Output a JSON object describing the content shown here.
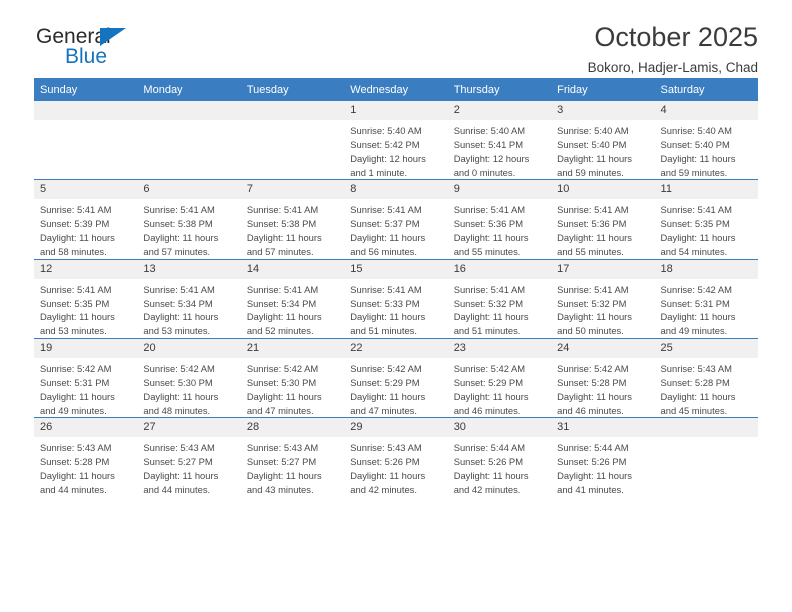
{
  "brand": {
    "word_one": "General",
    "word_two": "Blue"
  },
  "header": {
    "title": "October 2025",
    "subtitle": "Bokoro, Hadjer-Lamis, Chad"
  },
  "weekdays": [
    "Sunday",
    "Monday",
    "Tuesday",
    "Wednesday",
    "Thursday",
    "Friday",
    "Saturday"
  ],
  "colors": {
    "header_blue": "#3a7dc0",
    "brand_blue": "#1574bf",
    "daynum_band": "#f0f0f0",
    "text": "#3b3b3b"
  },
  "weeks": [
    [
      {
        "day": "",
        "empty": true,
        "sunrise": "",
        "sunset": "",
        "daylight_line1": "",
        "daylight_line2": ""
      },
      {
        "day": "",
        "empty": true,
        "sunrise": "",
        "sunset": "",
        "daylight_line1": "",
        "daylight_line2": ""
      },
      {
        "day": "",
        "empty": true,
        "sunrise": "",
        "sunset": "",
        "daylight_line1": "",
        "daylight_line2": ""
      },
      {
        "day": "1",
        "empty": false,
        "sunrise": "Sunrise: 5:40 AM",
        "sunset": "Sunset: 5:42 PM",
        "daylight_line1": "Daylight: 12 hours",
        "daylight_line2": "and 1 minute."
      },
      {
        "day": "2",
        "empty": false,
        "sunrise": "Sunrise: 5:40 AM",
        "sunset": "Sunset: 5:41 PM",
        "daylight_line1": "Daylight: 12 hours",
        "daylight_line2": "and 0 minutes."
      },
      {
        "day": "3",
        "empty": false,
        "sunrise": "Sunrise: 5:40 AM",
        "sunset": "Sunset: 5:40 PM",
        "daylight_line1": "Daylight: 11 hours",
        "daylight_line2": "and 59 minutes."
      },
      {
        "day": "4",
        "empty": false,
        "sunrise": "Sunrise: 5:40 AM",
        "sunset": "Sunset: 5:40 PM",
        "daylight_line1": "Daylight: 11 hours",
        "daylight_line2": "and 59 minutes."
      }
    ],
    [
      {
        "day": "5",
        "empty": false,
        "sunrise": "Sunrise: 5:41 AM",
        "sunset": "Sunset: 5:39 PM",
        "daylight_line1": "Daylight: 11 hours",
        "daylight_line2": "and 58 minutes."
      },
      {
        "day": "6",
        "empty": false,
        "sunrise": "Sunrise: 5:41 AM",
        "sunset": "Sunset: 5:38 PM",
        "daylight_line1": "Daylight: 11 hours",
        "daylight_line2": "and 57 minutes."
      },
      {
        "day": "7",
        "empty": false,
        "sunrise": "Sunrise: 5:41 AM",
        "sunset": "Sunset: 5:38 PM",
        "daylight_line1": "Daylight: 11 hours",
        "daylight_line2": "and 57 minutes."
      },
      {
        "day": "8",
        "empty": false,
        "sunrise": "Sunrise: 5:41 AM",
        "sunset": "Sunset: 5:37 PM",
        "daylight_line1": "Daylight: 11 hours",
        "daylight_line2": "and 56 minutes."
      },
      {
        "day": "9",
        "empty": false,
        "sunrise": "Sunrise: 5:41 AM",
        "sunset": "Sunset: 5:36 PM",
        "daylight_line1": "Daylight: 11 hours",
        "daylight_line2": "and 55 minutes."
      },
      {
        "day": "10",
        "empty": false,
        "sunrise": "Sunrise: 5:41 AM",
        "sunset": "Sunset: 5:36 PM",
        "daylight_line1": "Daylight: 11 hours",
        "daylight_line2": "and 55 minutes."
      },
      {
        "day": "11",
        "empty": false,
        "sunrise": "Sunrise: 5:41 AM",
        "sunset": "Sunset: 5:35 PM",
        "daylight_line1": "Daylight: 11 hours",
        "daylight_line2": "and 54 minutes."
      }
    ],
    [
      {
        "day": "12",
        "empty": false,
        "sunrise": "Sunrise: 5:41 AM",
        "sunset": "Sunset: 5:35 PM",
        "daylight_line1": "Daylight: 11 hours",
        "daylight_line2": "and 53 minutes."
      },
      {
        "day": "13",
        "empty": false,
        "sunrise": "Sunrise: 5:41 AM",
        "sunset": "Sunset: 5:34 PM",
        "daylight_line1": "Daylight: 11 hours",
        "daylight_line2": "and 53 minutes."
      },
      {
        "day": "14",
        "empty": false,
        "sunrise": "Sunrise: 5:41 AM",
        "sunset": "Sunset: 5:34 PM",
        "daylight_line1": "Daylight: 11 hours",
        "daylight_line2": "and 52 minutes."
      },
      {
        "day": "15",
        "empty": false,
        "sunrise": "Sunrise: 5:41 AM",
        "sunset": "Sunset: 5:33 PM",
        "daylight_line1": "Daylight: 11 hours",
        "daylight_line2": "and 51 minutes."
      },
      {
        "day": "16",
        "empty": false,
        "sunrise": "Sunrise: 5:41 AM",
        "sunset": "Sunset: 5:32 PM",
        "daylight_line1": "Daylight: 11 hours",
        "daylight_line2": "and 51 minutes."
      },
      {
        "day": "17",
        "empty": false,
        "sunrise": "Sunrise: 5:41 AM",
        "sunset": "Sunset: 5:32 PM",
        "daylight_line1": "Daylight: 11 hours",
        "daylight_line2": "and 50 minutes."
      },
      {
        "day": "18",
        "empty": false,
        "sunrise": "Sunrise: 5:42 AM",
        "sunset": "Sunset: 5:31 PM",
        "daylight_line1": "Daylight: 11 hours",
        "daylight_line2": "and 49 minutes."
      }
    ],
    [
      {
        "day": "19",
        "empty": false,
        "sunrise": "Sunrise: 5:42 AM",
        "sunset": "Sunset: 5:31 PM",
        "daylight_line1": "Daylight: 11 hours",
        "daylight_line2": "and 49 minutes."
      },
      {
        "day": "20",
        "empty": false,
        "sunrise": "Sunrise: 5:42 AM",
        "sunset": "Sunset: 5:30 PM",
        "daylight_line1": "Daylight: 11 hours",
        "daylight_line2": "and 48 minutes."
      },
      {
        "day": "21",
        "empty": false,
        "sunrise": "Sunrise: 5:42 AM",
        "sunset": "Sunset: 5:30 PM",
        "daylight_line1": "Daylight: 11 hours",
        "daylight_line2": "and 47 minutes."
      },
      {
        "day": "22",
        "empty": false,
        "sunrise": "Sunrise: 5:42 AM",
        "sunset": "Sunset: 5:29 PM",
        "daylight_line1": "Daylight: 11 hours",
        "daylight_line2": "and 47 minutes."
      },
      {
        "day": "23",
        "empty": false,
        "sunrise": "Sunrise: 5:42 AM",
        "sunset": "Sunset: 5:29 PM",
        "daylight_line1": "Daylight: 11 hours",
        "daylight_line2": "and 46 minutes."
      },
      {
        "day": "24",
        "empty": false,
        "sunrise": "Sunrise: 5:42 AM",
        "sunset": "Sunset: 5:28 PM",
        "daylight_line1": "Daylight: 11 hours",
        "daylight_line2": "and 46 minutes."
      },
      {
        "day": "25",
        "empty": false,
        "sunrise": "Sunrise: 5:43 AM",
        "sunset": "Sunset: 5:28 PM",
        "daylight_line1": "Daylight: 11 hours",
        "daylight_line2": "and 45 minutes."
      }
    ],
    [
      {
        "day": "26",
        "empty": false,
        "sunrise": "Sunrise: 5:43 AM",
        "sunset": "Sunset: 5:28 PM",
        "daylight_line1": "Daylight: 11 hours",
        "daylight_line2": "and 44 minutes."
      },
      {
        "day": "27",
        "empty": false,
        "sunrise": "Sunrise: 5:43 AM",
        "sunset": "Sunset: 5:27 PM",
        "daylight_line1": "Daylight: 11 hours",
        "daylight_line2": "and 44 minutes."
      },
      {
        "day": "28",
        "empty": false,
        "sunrise": "Sunrise: 5:43 AM",
        "sunset": "Sunset: 5:27 PM",
        "daylight_line1": "Daylight: 11 hours",
        "daylight_line2": "and 43 minutes."
      },
      {
        "day": "29",
        "empty": false,
        "sunrise": "Sunrise: 5:43 AM",
        "sunset": "Sunset: 5:26 PM",
        "daylight_line1": "Daylight: 11 hours",
        "daylight_line2": "and 42 minutes."
      },
      {
        "day": "30",
        "empty": false,
        "sunrise": "Sunrise: 5:44 AM",
        "sunset": "Sunset: 5:26 PM",
        "daylight_line1": "Daylight: 11 hours",
        "daylight_line2": "and 42 minutes."
      },
      {
        "day": "31",
        "empty": false,
        "sunrise": "Sunrise: 5:44 AM",
        "sunset": "Sunset: 5:26 PM",
        "daylight_line1": "Daylight: 11 hours",
        "daylight_line2": "and 41 minutes."
      },
      {
        "day": "",
        "empty": true,
        "sunrise": "",
        "sunset": "",
        "daylight_line1": "",
        "daylight_line2": ""
      }
    ]
  ]
}
